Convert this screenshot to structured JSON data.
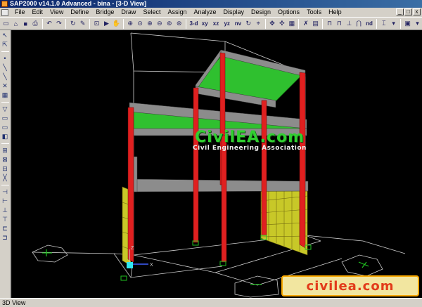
{
  "window": {
    "title": "SAP2000 v14.1.0 Advanced  - bina - [3-D View]",
    "controls": [
      "_",
      "□",
      "x"
    ]
  },
  "menu": [
    "File",
    "Edit",
    "View",
    "Define",
    "Bridge",
    "Draw",
    "Select",
    "Assign",
    "Analyze",
    "Display",
    "Design",
    "Options",
    "Tools",
    "Help"
  ],
  "toolbar": {
    "view_3d": "3-d",
    "view_xy": "xy",
    "view_xz": "xz",
    "view_yz": "yz",
    "view_nv": "nv",
    "nd_label": "nd"
  },
  "viewport": {
    "axis_z": "Z",
    "axis_x": "X",
    "watermark_logo": "CivilEA.com",
    "watermark_tagline": "Civil Engineering Association",
    "corner_watermark": "civilea.com"
  },
  "colors": {
    "background": "#000000",
    "columns": "#e02020",
    "slabs": "#2fc02f",
    "beams": "#8c8c8c",
    "walls": "#c8c828",
    "wireframe": "#d0d0d0",
    "supports": "#20c020"
  },
  "status_bar": {
    "text": "3D View"
  }
}
